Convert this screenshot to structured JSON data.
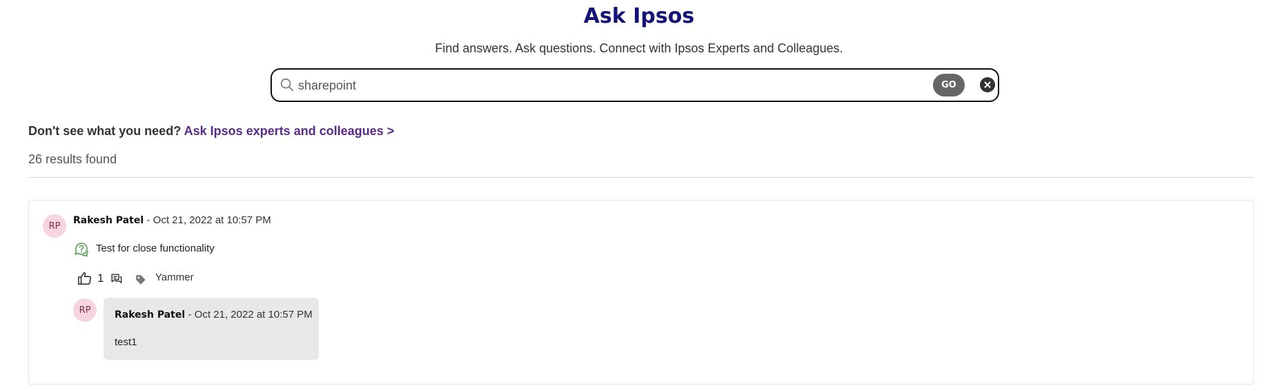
{
  "header": {
    "title": "Ask Ipsos",
    "subtitle": "Find answers. Ask questions. Connect with Ipsos Experts and Colleagues."
  },
  "search": {
    "value": "sharepoint",
    "go_label": "GO",
    "icon": "search-icon",
    "clear_icon": "close-icon"
  },
  "ask": {
    "prompt": "Don't see what you need?",
    "link_label": "Ask Ipsos experts and colleagues >"
  },
  "results": {
    "count_text": "26 results found",
    "items": [
      {
        "avatar_initials": "RP",
        "author": "Rakesh Patel",
        "date": "- Oct 21, 2022 at 10:57 PM",
        "question": "Test for close functionality",
        "likes": "1",
        "tag": "Yammer",
        "replies": [
          {
            "avatar_initials": "RP",
            "author": "Rakesh Patel",
            "date": "- Oct 21, 2022 at 10:57 PM",
            "text": "test1"
          }
        ]
      }
    ]
  },
  "colors": {
    "title": "#14137a",
    "link": "#5b2a8a",
    "go_button": "#666666",
    "avatar_bg": "#f6d5df",
    "question_icon": "#4e9a4a",
    "reply_bg": "#e8e8e8"
  }
}
